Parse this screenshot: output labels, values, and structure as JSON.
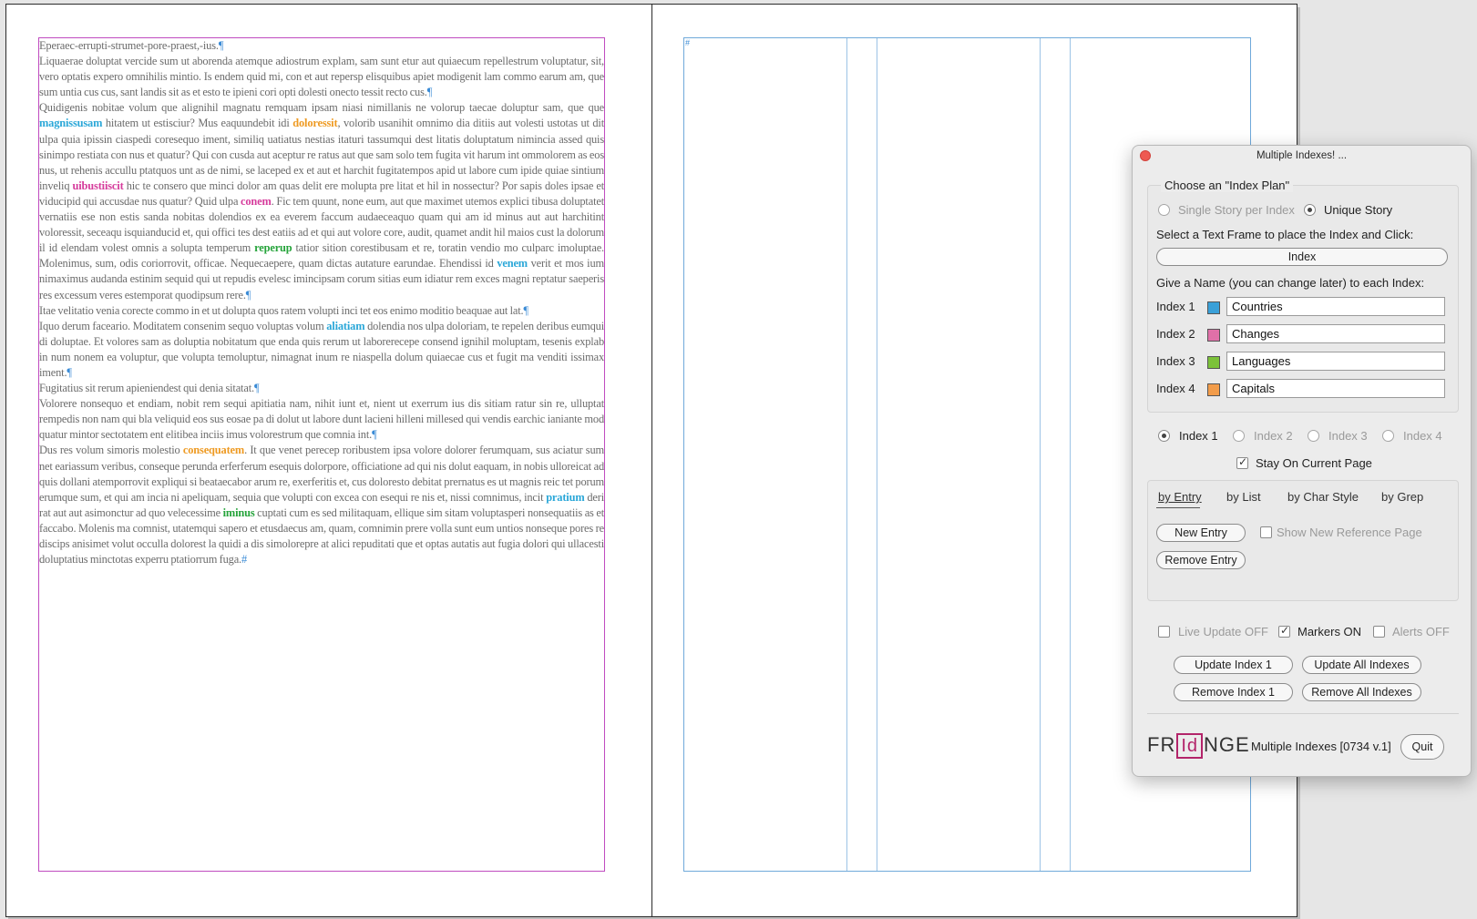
{
  "story": [
    [
      {
        "t": "Eperaec-errupti-strumet-pore-praest,-ius."
      },
      {
        "t": "¶",
        "c": "pil"
      }
    ],
    [
      {
        "t": "Liquaerae doluptat vercide sum ut aborenda atemque adiostrum explam, sam sunt etur aut quiaecum repellestrum voluptatur, sit, vero optatis expero omnihilis mintio. Is endem quid mi, con et aut repersp elisquibus apiet modigenit lam commo earum am, que sum untia cus cus, sant landis sit as et esto te ipieni cori opti dolesti onecto tessit recto cus."
      },
      {
        "t": "¶",
        "c": "pil"
      }
    ],
    [
      {
        "t": "Quidigenis nobitae volum que alignihil magnatu remquam ipsam niasi nimillanis ne volorup taecae doluptur sam, que que "
      },
      {
        "t": "magnissusam",
        "c": "hl c1"
      },
      {
        "t": " hitatem ut estisciur? Mus eaquundebit idi "
      },
      {
        "t": "doloressit",
        "c": "hl c4"
      },
      {
        "t": ", volorib usanihit omnimo dia ditiis aut volesti ustotas ut dit ulpa quia ipissin ciaspedi coresequo iment, similiq uatiatus nestias itaturi tassumqui dest litatis doluptatum nimincia assed quis sinimpo restiata con nus et quatur? Qui con cusda aut aceptur re ratus aut que sam solo tem fugita vit harum int ommolorem as eos nus, ut rehenis accullu ptatquos unt as de nimi, se laceped ex et aut et harchit fugitatempos apid ut labore cum ipide quiae sintium inveliq "
      },
      {
        "t": "uibustiiscit",
        "c": "hl c2"
      },
      {
        "t": " hic te consero que minci dolor am quas delit ere molupta pre litat et hil in nossectur? Por sapis doles ipsae et viducipid qui accusdae nus quatur? Quid ulpa "
      },
      {
        "t": "conem",
        "c": "hl c2"
      },
      {
        "t": ". Fic tem quunt, none eum, aut que maximet utemos explici tibusa doluptatet vernatiis ese non estis sanda nobitas dolendios ex ea everem faccum audaeceaquo quam qui am id minus aut aut harchitint voloressit, seceaqu isquianducid et, qui offici tes dest eatiis ad et qui aut volore core, audit, quamet andit hil maios cust la dolorum il id elendam volest omnis a solupta temperum "
      },
      {
        "t": "reperup",
        "c": "hl c3"
      },
      {
        "t": " tatior sition corestibusam et re, toratin vendio mo culparc imoluptae. Molenimus, sum, odis coriorrovit, officae. Nequecaepere, quam dictas autature earundae. Ehendissi id "
      },
      {
        "t": "venem",
        "c": "hl c1"
      },
      {
        "t": " verit et mos ium nimaximus audanda estinim sequid qui ut repudis evelesc imincipsam corum sitias eum idiatur rem exces magni reptatur saeperis res excessum veres estemporat quodipsum rere."
      },
      {
        "t": "¶",
        "c": "pil"
      }
    ],
    [
      {
        "t": "Itae velitatio venia corecte commo in et ut dolupta quos ratem volupti inci tet eos enimo moditio beaquae aut lat."
      },
      {
        "t": "¶",
        "c": "pil"
      }
    ],
    [
      {
        "t": "Iquo derum facea­rio. Moditatem consenim sequo voluptas volum "
      },
      {
        "t": "aliatiam",
        "c": "hl c1"
      },
      {
        "t": " dolendia nos ulpa doloriam, te repelen deribus eumqui di doluptae. Et volores sam as doluptia nobitatum que enda quis rerum ut laborerecepe consend ignihil moluptam, tesenis explab in num nonem ea voluptur, que volupta temoluptur, nimagnat inum re niaspella dolum quiaecae cus et fugit ma venditi issimax iment."
      },
      {
        "t": "¶",
        "c": "pil"
      }
    ],
    [
      {
        "t": "Fugitatius sit rerum apieniendest qui denia sitatat."
      },
      {
        "t": "¶",
        "c": "pil"
      }
    ],
    [
      {
        "t": "Volorere nonsequo et endiam, nobit rem sequi apitiatia nam, nihit iunt et, nient ut exerrum ius dis sitiam ratur sin re, ulluptat rempedis non nam qui bla veliquid eos sus eosae pa di dolut ut labore dunt lacieni hilleni millesed qui vendis earchic ianiante mod quatur mintor sectotatem ent elitibea inciis imus volorestrum que comnia int."
      },
      {
        "t": "¶",
        "c": "pil"
      }
    ],
    [
      {
        "t": "Dus res volum simoris molestio "
      },
      {
        "t": "consequatem",
        "c": "hl c4"
      },
      {
        "t": ". It que venet perecep roribustem ipsa volore dolorer ferumquam, sus aciatur sum net eariassum veribus, conseque perunda erferferum esequis dolorpore, officiatione ad qui nis dolut eaquam, in nobis ulloreicat ad quis dollani atemporrovit expliqui si beataecabor arum re, exerferitis et, cus doloresto debitat prernatus es ut magnis reic tet porum erumque sum, et qui am incia ni apeliquam, sequia que volupti con excea con esequi re nis et, nissi comnimus, incit "
      },
      {
        "t": "pratium",
        "c": "hl c1"
      },
      {
        "t": " deri rat aut aut asimonctur ad quo velecessime "
      },
      {
        "t": "iminus",
        "c": "hl c3"
      },
      {
        "t": " cuptati cum es sed militaquam, ellique sim sitam voluptasperi nonsequatiis as et faccabo. Molenis ma comnist, utatemqui sapero et etusdaecus am, quam, comnimin prere volla sunt eum untios nonseque pores re discips anisimet volut occulla dolorest la quidi a dis simolorepre at alici repuditati que et optas autatis aut fugia dolori qui ullacesti doluptatius minctotas experru ptatiorrum fuga."
      },
      {
        "t": "#",
        "c": "pil"
      }
    ]
  ],
  "panel": {
    "title": "Multiple Indexes! ...",
    "index_plan_label": "Choose an \"Index Plan\"",
    "plan_option_1": "Single Story per Index",
    "plan_option_2": "Unique Story",
    "select_frame_text": "Select a Text Frame to place the Index and Click:",
    "index_button": "Index",
    "give_name_text": "Give a Name (you can change later) to each Index:",
    "indexes": [
      {
        "label": "Index 1",
        "name": "Countries",
        "color": "#3aa0d8"
      },
      {
        "label": "Index 2",
        "name": "Changes",
        "color": "#e070a8"
      },
      {
        "label": "Index 3",
        "name": "Languages",
        "color": "#7cc23a"
      },
      {
        "label": "Index 4",
        "name": "Capitals",
        "color": "#f29c4a"
      }
    ],
    "radio_index_1": "Index 1",
    "radio_index_2": "Index 2",
    "radio_index_3": "Index 3",
    "radio_index_4": "Index 4",
    "stay_on_page": "Stay On Current Page",
    "tabs": [
      "by Entry",
      "by List",
      "by Char Style",
      "by Grep"
    ],
    "new_entry": "New Entry",
    "show_new_ref": "Show New Reference Page",
    "remove_entry": "Remove Entry",
    "live_update": "Live Update OFF",
    "markers_on": "Markers ON",
    "alerts_off": "Alerts OFF",
    "update_index": "Update Index 1",
    "update_all": "Update All Indexes",
    "remove_index": "Remove Index 1",
    "remove_all": "Remove All Indexes",
    "logo_pre": "FR",
    "logo_box": "Id",
    "logo_post": "NGE",
    "version": "Multiple Indexes [0734 v.1]",
    "quit": "Quit"
  }
}
